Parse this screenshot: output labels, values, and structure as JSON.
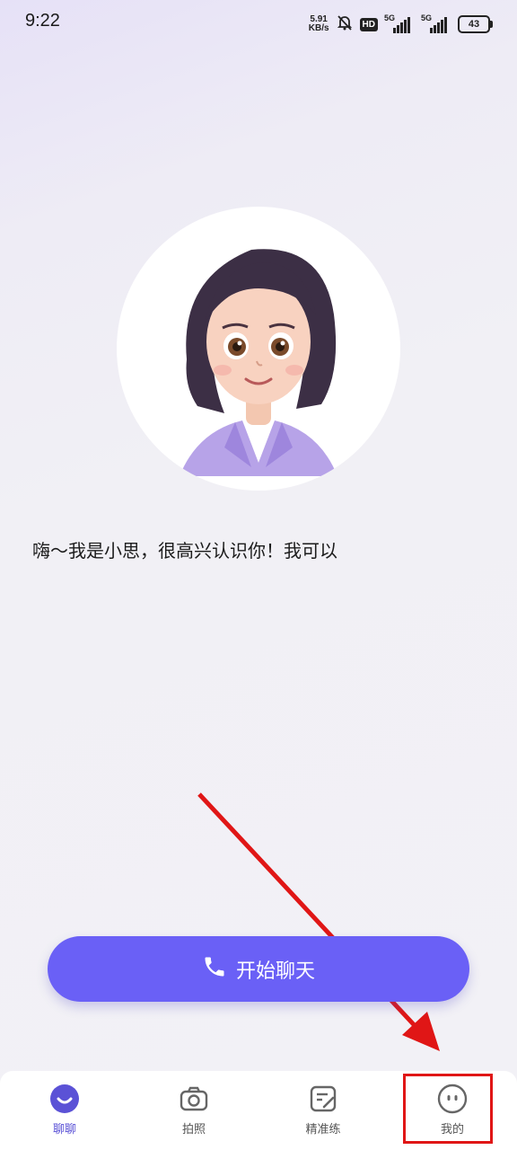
{
  "status_bar": {
    "time": "9:22",
    "speed_value": "5.91",
    "speed_unit": "KB/s",
    "hd": "HD",
    "sim1": "5G",
    "sim2": "5G",
    "battery": "43"
  },
  "assistant": {
    "greeting": "嗨～我是小思，很高兴认识你！我可以"
  },
  "start_button": {
    "label": "开始聊天",
    "color": "#6a60f6"
  },
  "tabs": [
    {
      "label": "聊聊",
      "icon": "chat-face-icon",
      "active": true
    },
    {
      "label": "拍照",
      "icon": "camera-icon",
      "active": false
    },
    {
      "label": "精准练",
      "icon": "practice-edit-icon",
      "active": false
    },
    {
      "label": "我的",
      "icon": "profile-face-icon",
      "active": false
    }
  ],
  "annotation": {
    "color": "#e01616"
  }
}
